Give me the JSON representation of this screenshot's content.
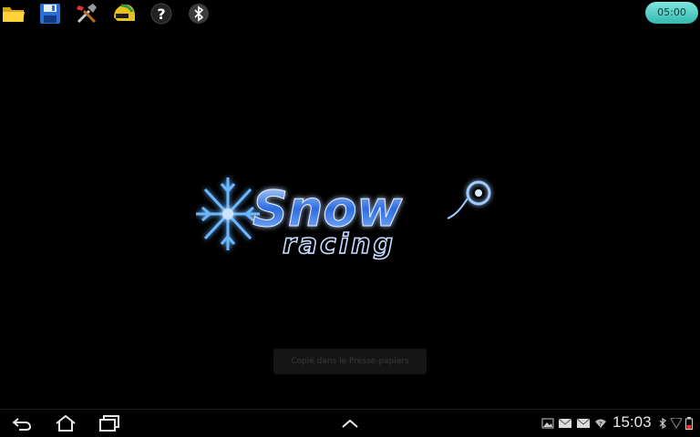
{
  "toolbar": {
    "icons": [
      "folder-icon",
      "save-icon",
      "tools-icon",
      "helmet-icon",
      "help-icon",
      "bluetooth-icon"
    ],
    "help_glyph": "?",
    "timer_label": "05:00"
  },
  "splash": {
    "logo_title": "Snow",
    "logo_subtitle": "racing"
  },
  "toast": {
    "text": "Copié dans le Presse-papiers"
  },
  "system_bar": {
    "clock": "15:03",
    "nav_icons": [
      "back-icon",
      "home-icon",
      "recent-apps-icon",
      "expand-up-icon"
    ],
    "status_icons": [
      "gallery-icon",
      "email-icon",
      "email-icon",
      "wifi-icon",
      "bluetooth-icon",
      "signal-icon",
      "battery-icon"
    ]
  },
  "colors": {
    "background": "#000000",
    "timer_accent": "#4ccfc6",
    "logo_blue": "#4a9dff"
  }
}
